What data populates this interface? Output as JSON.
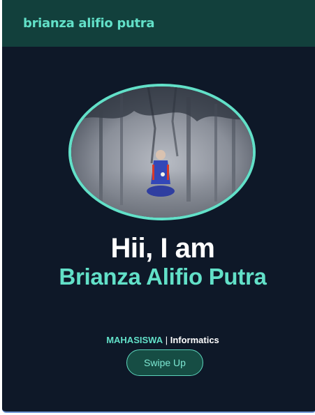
{
  "navbar": {
    "brand": "brianza alifio putra"
  },
  "hero": {
    "photo_icon": "profile-photo",
    "greeting": "Hii, I am",
    "name": "Brianza Alifio Putra",
    "role": "MAHASISWA",
    "separator": " | ",
    "field": "Informatics",
    "swipe_label": "Swipe Up"
  },
  "colors": {
    "accent": "#62e0c8",
    "background": "#0e1828",
    "navbar": "#12403c"
  }
}
